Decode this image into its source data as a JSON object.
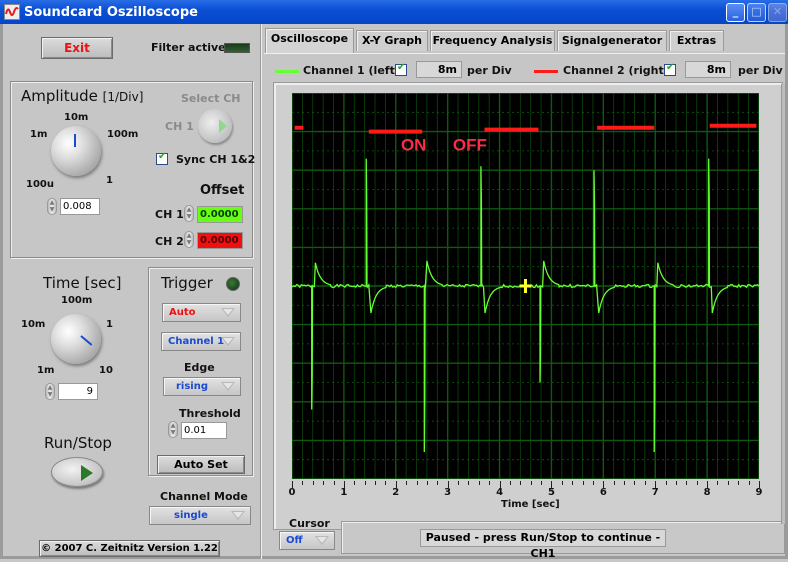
{
  "window": {
    "title": "Soundcard Oszilloscope",
    "controls": [
      "minimize",
      "maximize",
      "close"
    ]
  },
  "left_panel": {
    "exit_label": "Exit",
    "filter_label": "Filter active",
    "filter_active": false,
    "amplitude": {
      "title": "Amplitude",
      "unit": "[1/Div]",
      "knob_labels": [
        "100u",
        "1m",
        "10m",
        "100m",
        "1"
      ],
      "value": "0.008"
    },
    "select_ch": {
      "label": "Select CH",
      "value": "CH 1"
    },
    "sync": {
      "label": "Sync CH 1&2",
      "checked": true
    },
    "offset": {
      "title": "Offset",
      "ch1_label": "CH 1",
      "ch1_value": "0.0000",
      "ch2_label": "CH 2",
      "ch2_value": "0.0000"
    },
    "time": {
      "title": "Time [sec]",
      "knob_labels": [
        "1m",
        "10m",
        "100m",
        "1",
        "10"
      ],
      "value": "9"
    },
    "trigger": {
      "title": "Trigger",
      "mode": "Auto",
      "channel": "Channel 1",
      "edge_label": "Edge",
      "edge": "rising",
      "threshold_label": "Threshold",
      "threshold": "0.01",
      "auto_set_label": "Auto Set"
    },
    "run_stop_label": "Run/Stop",
    "channel_mode": {
      "label": "Channel Mode",
      "value": "single"
    },
    "copyright": "© 2007  C. Zeitnitz Version 1.22"
  },
  "tabs": [
    {
      "label": "Oscilloscope",
      "active": true
    },
    {
      "label": "X-Y Graph",
      "active": false
    },
    {
      "label": "Frequency Analysis",
      "active": false
    },
    {
      "label": "Signalgenerator",
      "active": false
    },
    {
      "label": "Extras",
      "active": false
    }
  ],
  "channels": {
    "ch1": {
      "label": "Channel 1 (left)",
      "enabled": true,
      "per_div": "8m",
      "per_div_label": "per Div",
      "color": "#66ff33"
    },
    "ch2": {
      "label": "Channel 2 (right)",
      "enabled": true,
      "per_div": "8m",
      "per_div_label": "per Div",
      "color": "#ff1a1a"
    }
  },
  "cursor": {
    "label": "Cursor",
    "value": "Off"
  },
  "status": "Paused - press Run/Stop to continue - CH1",
  "chart_data": {
    "type": "line",
    "title": "",
    "xlabel": "Time [sec]",
    "ylabel": "",
    "xlim": [
      0,
      9
    ],
    "x_ticks": [
      "0",
      "1",
      "2",
      "3",
      "4",
      "5",
      "6",
      "7",
      "8",
      "9"
    ],
    "y_divisions": 10,
    "grid": true,
    "background": "#000000",
    "grid_color": "#0f5a0f",
    "annotations": [
      {
        "text": "ON",
        "x": 2.1,
        "color": "#ff2a4a"
      },
      {
        "text": "OFF",
        "x": 3.1,
        "color": "#ff2a4a"
      }
    ],
    "cursor_marker": {
      "x": 4.5,
      "y_div": 0.0,
      "color": "#ffff33"
    },
    "series": [
      {
        "name": "Channel 1 (left)",
        "color": "#66ff33",
        "baseline_div": 0.0,
        "events": [
          {
            "x": 0.38,
            "type": "spike-down",
            "peak_div": -3.2
          },
          {
            "x": 0.45,
            "type": "bump-up",
            "peak_div": 0.6
          },
          {
            "x": 1.43,
            "type": "spike-up",
            "peak_div": 3.3
          },
          {
            "x": 1.52,
            "type": "dip-down",
            "peak_div": -0.7
          },
          {
            "x": 2.55,
            "type": "spike-down",
            "peak_div": -4.3
          },
          {
            "x": 2.6,
            "type": "bump-up",
            "peak_div": 0.65
          },
          {
            "x": 3.64,
            "type": "spike-up",
            "peak_div": 3.1
          },
          {
            "x": 3.72,
            "type": "dip-down",
            "peak_div": -0.7
          },
          {
            "x": 4.78,
            "type": "spike-down",
            "peak_div": -2.5
          },
          {
            "x": 4.85,
            "type": "bump-up",
            "peak_div": 0.65
          },
          {
            "x": 5.82,
            "type": "spike-up",
            "peak_div": 3.0
          },
          {
            "x": 5.91,
            "type": "dip-down",
            "peak_div": -0.7
          },
          {
            "x": 6.98,
            "type": "spike-down",
            "peak_div": -4.3
          },
          {
            "x": 7.05,
            "type": "bump-up",
            "peak_div": 0.6
          },
          {
            "x": 8.03,
            "type": "spike-up",
            "peak_div": 3.3
          },
          {
            "x": 8.1,
            "type": "dip-down",
            "peak_div": -0.7
          }
        ]
      },
      {
        "name": "Channel 2 (right)",
        "color": "#ff1a1a",
        "segments": [
          {
            "x0": 0.05,
            "x1": 0.22,
            "y_div": 4.1
          },
          {
            "x0": 1.48,
            "x1": 2.51,
            "y_div": 4.0
          },
          {
            "x0": 3.71,
            "x1": 4.75,
            "y_div": 4.05
          },
          {
            "x0": 5.88,
            "x1": 6.98,
            "y_div": 4.1
          },
          {
            "x0": 8.05,
            "x1": 8.95,
            "y_div": 4.15
          }
        ]
      }
    ]
  }
}
